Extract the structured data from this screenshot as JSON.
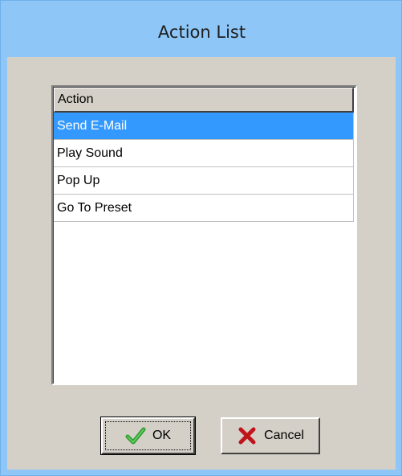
{
  "window": {
    "title": "Action List"
  },
  "list": {
    "header": "Action",
    "rows": [
      "Send E-Mail",
      "Play Sound",
      "Pop Up",
      "Go To Preset"
    ],
    "selected": "Send E-Mail"
  },
  "buttons": {
    "ok_label": "OK",
    "cancel_label": "Cancel"
  },
  "icons": {
    "ok": "check-icon",
    "cancel": "x-icon"
  },
  "colors": {
    "title_bar": "#8ec7f7",
    "selection": "#3399ff",
    "dialog_face": "#d4d0c8",
    "check_green": "#2e9e2e",
    "x_red": "#c0141b"
  }
}
